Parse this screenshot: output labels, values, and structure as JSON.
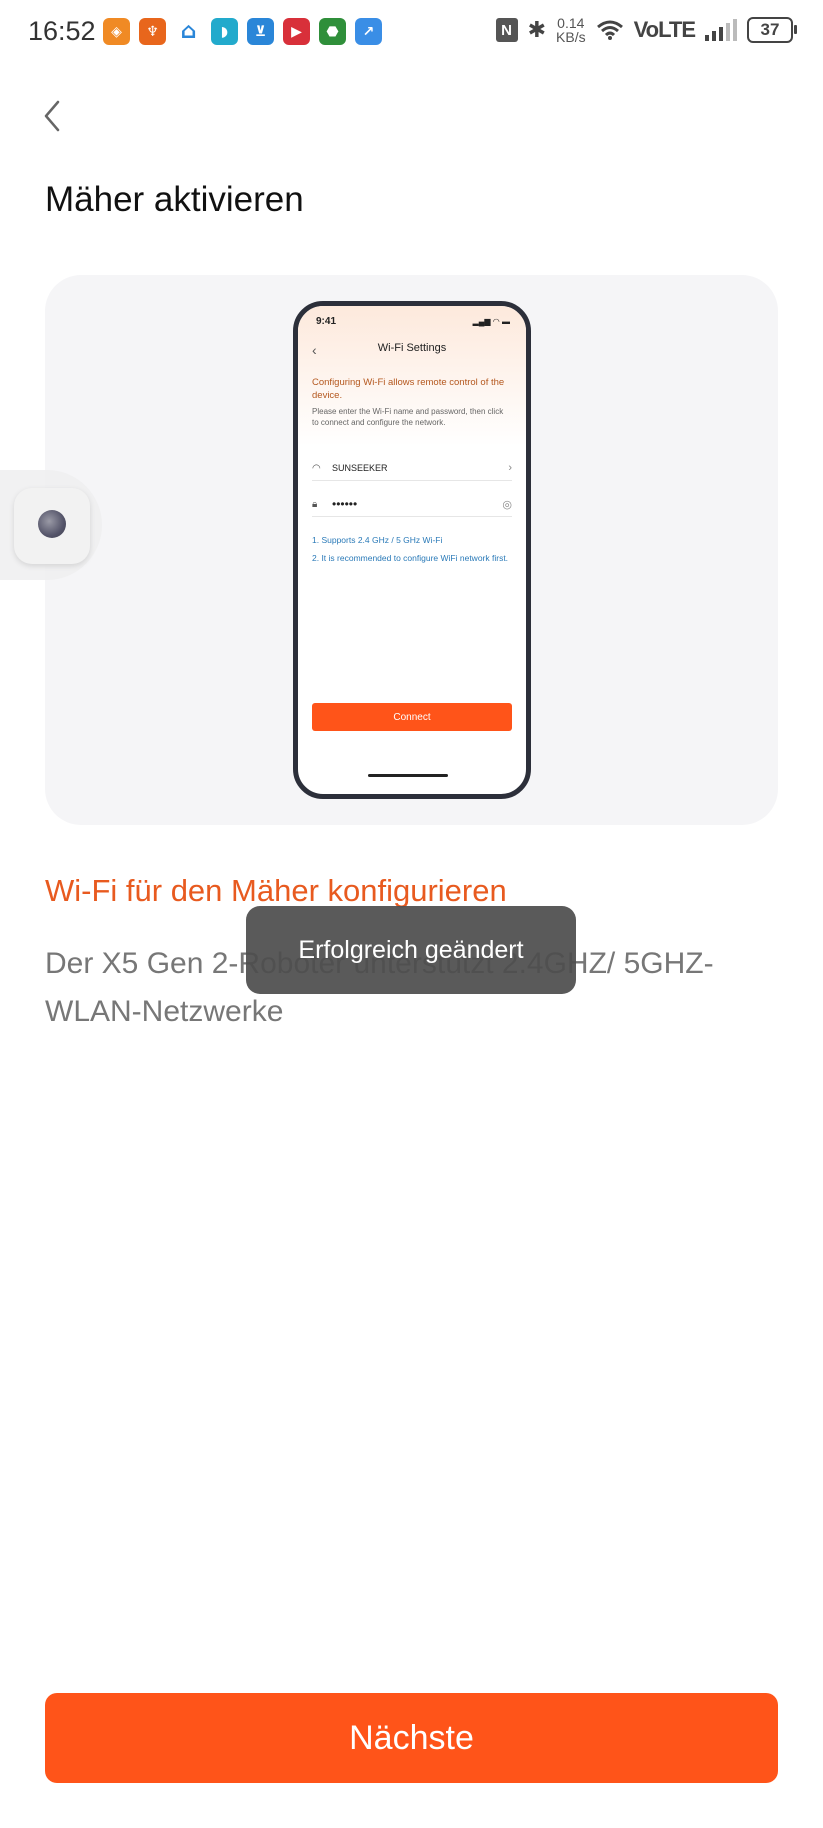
{
  "status_bar": {
    "time": "16:52",
    "net_speed_value": "0.14",
    "net_speed_unit": "KB/s",
    "network_label": "VoLTE",
    "battery": "37",
    "nfc": "N",
    "app_icons": [
      {
        "name": "app-icon-1",
        "color": "#f08a24",
        "glyph": "◈"
      },
      {
        "name": "app-icon-2",
        "color": "#e8661c",
        "glyph": "♆"
      },
      {
        "name": "app-icon-3",
        "color": "#ffffff",
        "glyph": "⌂"
      },
      {
        "name": "app-icon-4",
        "color": "#22aacc",
        "glyph": "◗"
      },
      {
        "name": "app-icon-5",
        "color": "#2a86d8",
        "glyph": "⊻"
      },
      {
        "name": "app-icon-6",
        "color": "#d8303a",
        "glyph": "▶"
      },
      {
        "name": "app-icon-7",
        "color": "#2f8f3a",
        "glyph": "⬣"
      },
      {
        "name": "app-icon-8",
        "color": "#3a8ee6",
        "glyph": "↗"
      }
    ]
  },
  "page": {
    "title": "Mäher aktivieren",
    "section_title": "Wi-Fi für den Mäher konfigurieren",
    "description": "Der X5 Gen 2-Roboter unterstützt 2.4GHZ/ 5GHZ-WLAN-Netzwerke",
    "next_button": "Nächste"
  },
  "illustration": {
    "time": "9:41",
    "status": "▂▄▆ ◠ ▬",
    "back": "‹",
    "title": "Wi-Fi Settings",
    "heading": "Configuring Wi-Fi allows remote control of the device.",
    "subtext": "Please enter the Wi-Fi name and password, then click to connect and configure the network.",
    "wifi_name": "SUNSEEKER",
    "password": "••••••",
    "note_1": "1. Supports 2.4 GHz / 5 GHz Wi-Fi",
    "note_2": "2. It is recommended to configure WiFi network first.",
    "connect_button": "Connect"
  },
  "toast": "Erfolgreich geändert",
  "colors": {
    "accent": "#ff5419",
    "section_title": "#e85a1f",
    "text": "#111111",
    "muted": "#777777"
  }
}
